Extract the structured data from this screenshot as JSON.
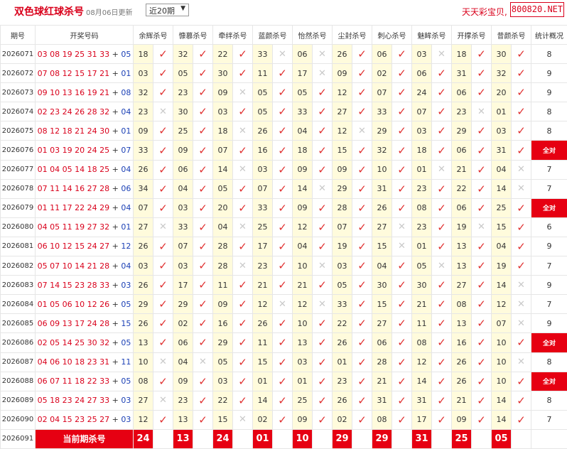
{
  "header": {
    "title": "双色球红球杀号",
    "date": "08月06日更新",
    "period_select": "近20期",
    "brand": "天天彩宝贝,",
    "url": "800820.NET"
  },
  "columns": {
    "period": "期号",
    "draw": "开奖号码",
    "methods": [
      "余辉杀号",
      "慷慕杀号",
      "牵绊杀号",
      "蓝颜杀号",
      "怡然杀号",
      "尘封杀号",
      "刺心杀号",
      "魅眸杀号",
      "开撑杀号",
      "昔颜杀号"
    ],
    "stats": "统计概况"
  },
  "rows": [
    {
      "period": "2026071",
      "red": "03 08 19 25 31 33",
      "blue": "05",
      "kills": [
        "18",
        "32",
        "22",
        "33",
        "06",
        "26",
        "06",
        "03",
        "18",
        "30"
      ],
      "ok": [
        1,
        1,
        1,
        0,
        0,
        1,
        1,
        0,
        1,
        1
      ],
      "stat": "8"
    },
    {
      "period": "2026072",
      "red": "07 08 12 15 17 21",
      "blue": "01",
      "kills": [
        "03",
        "05",
        "30",
        "11",
        "17",
        "09",
        "02",
        "06",
        "31",
        "32"
      ],
      "ok": [
        1,
        1,
        1,
        1,
        0,
        1,
        1,
        1,
        1,
        1
      ],
      "stat": "9"
    },
    {
      "period": "2026073",
      "red": "09 10 13 16 19 21",
      "blue": "08",
      "kills": [
        "32",
        "23",
        "09",
        "05",
        "05",
        "12",
        "07",
        "24",
        "06",
        "20"
      ],
      "ok": [
        1,
        1,
        0,
        1,
        1,
        1,
        1,
        1,
        1,
        1
      ],
      "stat": "9"
    },
    {
      "period": "2026074",
      "red": "02 23 24 26 28 32",
      "blue": "04",
      "kills": [
        "23",
        "30",
        "03",
        "05",
        "33",
        "27",
        "33",
        "07",
        "23",
        "01"
      ],
      "ok": [
        0,
        1,
        1,
        1,
        1,
        1,
        1,
        1,
        0,
        1
      ],
      "stat": "8"
    },
    {
      "period": "2026075",
      "red": "08 12 18 21 24 30",
      "blue": "01",
      "kills": [
        "09",
        "25",
        "18",
        "26",
        "04",
        "12",
        "29",
        "03",
        "29",
        "03"
      ],
      "ok": [
        1,
        1,
        0,
        1,
        1,
        0,
        1,
        1,
        1,
        1
      ],
      "stat": "8"
    },
    {
      "period": "2026076",
      "red": "01 03 19 20 24 25",
      "blue": "07",
      "kills": [
        "33",
        "09",
        "07",
        "16",
        "18",
        "15",
        "32",
        "18",
        "06",
        "31"
      ],
      "ok": [
        1,
        1,
        1,
        1,
        1,
        1,
        1,
        1,
        1,
        1
      ],
      "stat": "全对"
    },
    {
      "period": "2026077",
      "red": "01 04 05 14 18 25",
      "blue": "04",
      "kills": [
        "26",
        "06",
        "14",
        "03",
        "09",
        "09",
        "10",
        "01",
        "21",
        "04"
      ],
      "ok": [
        1,
        1,
        0,
        1,
        1,
        1,
        1,
        0,
        1,
        0
      ],
      "stat": "7"
    },
    {
      "period": "2026078",
      "red": "07 11 14 16 27 28",
      "blue": "06",
      "kills": [
        "34",
        "04",
        "05",
        "07",
        "14",
        "29",
        "31",
        "23",
        "22",
        "14"
      ],
      "ok": [
        1,
        1,
        1,
        1,
        0,
        1,
        1,
        1,
        1,
        0
      ],
      "stat": "7"
    },
    {
      "period": "2026079",
      "red": "01 11 17 22 24 29",
      "blue": "04",
      "kills": [
        "07",
        "03",
        "20",
        "33",
        "09",
        "28",
        "26",
        "08",
        "06",
        "25"
      ],
      "ok": [
        1,
        1,
        1,
        1,
        1,
        1,
        1,
        1,
        1,
        1
      ],
      "stat": "全对"
    },
    {
      "period": "2026080",
      "red": "04 05 11 19 27 32",
      "blue": "01",
      "kills": [
        "27",
        "33",
        "04",
        "25",
        "12",
        "07",
        "27",
        "23",
        "19",
        "15"
      ],
      "ok": [
        0,
        1,
        0,
        1,
        1,
        1,
        0,
        1,
        0,
        1
      ],
      "stat": "6"
    },
    {
      "period": "2026081",
      "red": "06 10 12 15 24 27",
      "blue": "12",
      "kills": [
        "26",
        "07",
        "28",
        "17",
        "04",
        "19",
        "15",
        "01",
        "13",
        "04"
      ],
      "ok": [
        1,
        1,
        1,
        1,
        1,
        1,
        0,
        1,
        1,
        1
      ],
      "stat": "9"
    },
    {
      "period": "2026082",
      "red": "05 07 10 14 21 28",
      "blue": "04",
      "kills": [
        "03",
        "03",
        "28",
        "23",
        "10",
        "03",
        "04",
        "05",
        "13",
        "19"
      ],
      "ok": [
        1,
        1,
        0,
        1,
        0,
        1,
        1,
        0,
        1,
        1
      ],
      "stat": "7"
    },
    {
      "period": "2026083",
      "red": "07 14 15 23 28 33",
      "blue": "03",
      "kills": [
        "26",
        "17",
        "11",
        "21",
        "21",
        "05",
        "30",
        "30",
        "27",
        "14"
      ],
      "ok": [
        1,
        1,
        1,
        1,
        1,
        1,
        1,
        1,
        1,
        0
      ],
      "stat": "9"
    },
    {
      "period": "2026084",
      "red": "01 05 06 10 12 26",
      "blue": "05",
      "kills": [
        "29",
        "29",
        "09",
        "12",
        "12",
        "33",
        "15",
        "21",
        "08",
        "12"
      ],
      "ok": [
        1,
        1,
        1,
        0,
        0,
        1,
        1,
        1,
        1,
        0
      ],
      "stat": "7"
    },
    {
      "period": "2026085",
      "red": "06 09 13 17 24 28",
      "blue": "15",
      "kills": [
        "26",
        "02",
        "16",
        "26",
        "10",
        "22",
        "27",
        "11",
        "13",
        "07"
      ],
      "ok": [
        1,
        1,
        1,
        1,
        1,
        1,
        1,
        1,
        1,
        0
      ],
      "stat": "9"
    },
    {
      "period": "2026086",
      "red": "02 05 14 25 30 32",
      "blue": "05",
      "kills": [
        "13",
        "06",
        "29",
        "11",
        "13",
        "26",
        "06",
        "08",
        "16",
        "10"
      ],
      "ok": [
        1,
        1,
        1,
        1,
        1,
        1,
        1,
        1,
        1,
        1
      ],
      "stat": "全对"
    },
    {
      "period": "2026087",
      "red": "04 06 10 18 23 31",
      "blue": "11",
      "kills": [
        "10",
        "04",
        "05",
        "15",
        "03",
        "01",
        "28",
        "12",
        "26",
        "10"
      ],
      "ok": [
        0,
        0,
        1,
        1,
        1,
        1,
        1,
        1,
        1,
        0
      ],
      "stat": "8"
    },
    {
      "period": "2026088",
      "red": "06 07 11 18 22 33",
      "blue": "05",
      "kills": [
        "08",
        "09",
        "03",
        "01",
        "01",
        "23",
        "21",
        "14",
        "26",
        "10"
      ],
      "ok": [
        1,
        1,
        1,
        1,
        1,
        1,
        1,
        1,
        1,
        1
      ],
      "stat": "全对"
    },
    {
      "period": "2026089",
      "red": "05 18 23 24 27 33",
      "blue": "03",
      "kills": [
        "27",
        "23",
        "22",
        "14",
        "25",
        "26",
        "31",
        "31",
        "21",
        "14"
      ],
      "ok": [
        0,
        1,
        1,
        1,
        1,
        1,
        1,
        1,
        1,
        1
      ],
      "stat": "8"
    },
    {
      "period": "2026090",
      "red": "02 04 15 23 25 27",
      "blue": "03",
      "kills": [
        "12",
        "13",
        "15",
        "02",
        "09",
        "02",
        "08",
        "17",
        "09",
        "14"
      ],
      "ok": [
        1,
        1,
        0,
        1,
        1,
        1,
        1,
        1,
        1,
        1
      ],
      "stat": "7"
    }
  ],
  "current": {
    "period": "2026091",
    "label": "当前期杀号",
    "kills": [
      "24",
      "13",
      "24",
      "01",
      "10",
      "29",
      "29",
      "31",
      "25",
      "05"
    ]
  },
  "marks": {
    "ok": "✓",
    "no": "✕"
  },
  "colors": {
    "accent": "#d9001b",
    "blue_ball": "#1a3fb5",
    "kill_bg": "#fffbdc",
    "banner": "#e60012"
  }
}
